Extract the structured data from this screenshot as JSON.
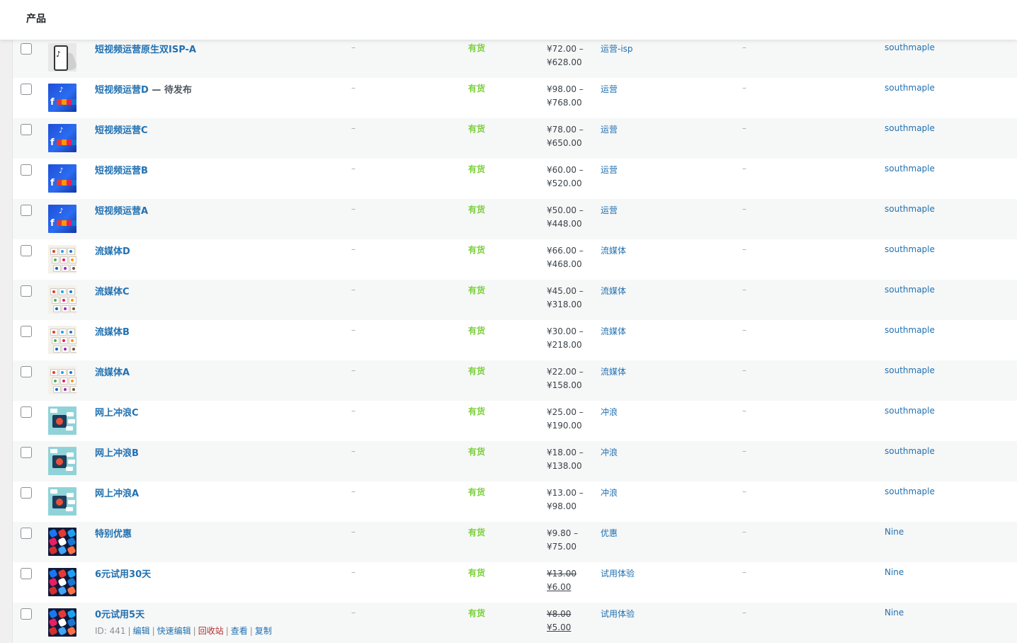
{
  "header": {
    "title": "产品"
  },
  "products": [
    {
      "name": "短视频运营原生双ISP-A",
      "state": "",
      "sku": "–",
      "stock": "有货",
      "price_line1": "¥72.00 –",
      "price_line2": "¥628.00",
      "sale": false,
      "category": "运营-isp",
      "tags": "–",
      "author": "southmaple",
      "thumb": "tiktok-phone-image"
    },
    {
      "name": "短视频运营D",
      "state": " — 待发布",
      "sku": "–",
      "stock": "有货",
      "price_line1": "¥98.00 –",
      "price_line2": "¥768.00",
      "sale": false,
      "category": "运营",
      "tags": "–",
      "author": "southmaple",
      "thumb": "social-icons-image"
    },
    {
      "name": "短视频运营C",
      "state": "",
      "sku": "–",
      "stock": "有货",
      "price_line1": "¥78.00 –",
      "price_line2": "¥650.00",
      "sale": false,
      "category": "运营",
      "tags": "–",
      "author": "southmaple",
      "thumb": "social-icons-image"
    },
    {
      "name": "短视频运营B",
      "state": "",
      "sku": "–",
      "stock": "有货",
      "price_line1": "¥60.00 –",
      "price_line2": "¥520.00",
      "sale": false,
      "category": "运营",
      "tags": "–",
      "author": "southmaple",
      "thumb": "social-icons-image"
    },
    {
      "name": "短视频运营A",
      "state": "",
      "sku": "–",
      "stock": "有货",
      "price_line1": "¥50.00 –",
      "price_line2": "¥448.00",
      "sale": false,
      "category": "运营",
      "tags": "–",
      "author": "southmaple",
      "thumb": "social-icons-image"
    },
    {
      "name": "流媒体D",
      "state": "",
      "sku": "–",
      "stock": "有货",
      "price_line1": "¥66.00 –",
      "price_line2": "¥468.00",
      "sale": false,
      "category": "流媒体",
      "tags": "–",
      "author": "southmaple",
      "thumb": "keyboard-keys-image"
    },
    {
      "name": "流媒体C",
      "state": "",
      "sku": "–",
      "stock": "有货",
      "price_line1": "¥45.00 –",
      "price_line2": "¥318.00",
      "sale": false,
      "category": "流媒体",
      "tags": "–",
      "author": "southmaple",
      "thumb": "keyboard-keys-image"
    },
    {
      "name": "流媒体B",
      "state": "",
      "sku": "–",
      "stock": "有货",
      "price_line1": "¥30.00 –",
      "price_line2": "¥218.00",
      "sale": false,
      "category": "流媒体",
      "tags": "–",
      "author": "southmaple",
      "thumb": "keyboard-keys-image"
    },
    {
      "name": "流媒体A",
      "state": "",
      "sku": "–",
      "stock": "有货",
      "price_line1": "¥22.00 –",
      "price_line2": "¥158.00",
      "sale": false,
      "category": "流媒体",
      "tags": "–",
      "author": "southmaple",
      "thumb": "keyboard-keys-image"
    },
    {
      "name": "网上冲浪C",
      "state": "",
      "sku": "–",
      "stock": "有货",
      "price_line1": "¥25.00 –",
      "price_line2": "¥190.00",
      "sale": false,
      "category": "冲浪",
      "tags": "–",
      "author": "southmaple",
      "thumb": "surfing-screen-image"
    },
    {
      "name": "网上冲浪B",
      "state": "",
      "sku": "–",
      "stock": "有货",
      "price_line1": "¥18.00 –",
      "price_line2": "¥138.00",
      "sale": false,
      "category": "冲浪",
      "tags": "–",
      "author": "southmaple",
      "thumb": "surfing-screen-image"
    },
    {
      "name": "网上冲浪A",
      "state": "",
      "sku": "–",
      "stock": "有货",
      "price_line1": "¥13.00 –",
      "price_line2": "¥98.00",
      "sale": false,
      "category": "冲浪",
      "tags": "–",
      "author": "southmaple",
      "thumb": "surfing-screen-image"
    },
    {
      "name": "特别优惠",
      "state": "",
      "sku": "–",
      "stock": "有货",
      "price_line1": "¥9.80 –",
      "price_line2": "¥75.00",
      "sale": false,
      "category": "优惠",
      "tags": "–",
      "author": "Nine",
      "thumb": "app-icons-image"
    },
    {
      "name": "6元试用30天",
      "state": "",
      "sku": "–",
      "stock": "有货",
      "price_line1": "¥13.00",
      "price_line2": "¥6.00",
      "sale": true,
      "category": "试用体验",
      "tags": "–",
      "author": "Nine",
      "thumb": "app-icons-image"
    },
    {
      "name": "0元试用5天",
      "state": "",
      "sku": "–",
      "stock": "有货",
      "price_line1": "¥8.00",
      "price_line2": "¥5.00",
      "sale": true,
      "category": "试用体验",
      "tags": "–",
      "author": "Nine",
      "thumb": "app-icons-image",
      "row_actions": {
        "id_text": "ID: 441",
        "edit": "编辑",
        "quick_edit": "快速编辑",
        "trash": "回收站",
        "view": "查看",
        "duplicate": "复制",
        "separator": "|"
      }
    }
  ]
}
